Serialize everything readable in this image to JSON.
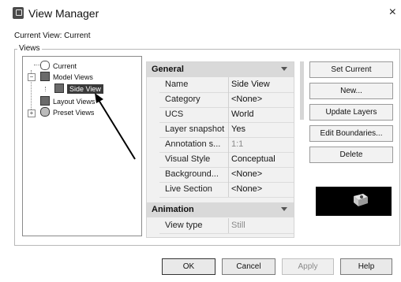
{
  "window": {
    "title": "View Manager",
    "close_glyph": "×"
  },
  "current_view_label": "Current View: Current",
  "views_group_label": "Views",
  "tree": {
    "current": "Current",
    "model_views": "Model Views",
    "side_view": "Side View",
    "layout_views": "Layout Views",
    "preset_views": "Preset Views",
    "expand_glyph": "+",
    "collapse_glyph": "−"
  },
  "properties": {
    "general_header": "General",
    "general_rows": [
      {
        "key": "Name",
        "value": "Side View"
      },
      {
        "key": "Category",
        "value": "<None>"
      },
      {
        "key": "UCS",
        "value": "World"
      },
      {
        "key": "Layer snapshot",
        "value": "Yes"
      },
      {
        "key": "Annotation s...",
        "value": "1:1"
      },
      {
        "key": "Visual Style",
        "value": "Conceptual"
      },
      {
        "key": "Background...",
        "value": "<None>"
      },
      {
        "key": "Live Section",
        "value": "<None>"
      }
    ],
    "animation_header": "Animation",
    "animation_rows": [
      {
        "key": "View type",
        "value": "Still"
      }
    ]
  },
  "side_buttons": {
    "set_current": "Set Current",
    "new": "New...",
    "update_layers": "Update Layers",
    "edit_boundaries": "Edit Boundaries...",
    "delete": "Delete"
  },
  "bottom_buttons": {
    "ok": "OK",
    "cancel": "Cancel",
    "apply": "Apply",
    "help": "Help"
  },
  "icons": {
    "app": "autocad-view-manager-icon",
    "preview": "3d-part-preview-icon"
  },
  "colors": {
    "selection": "#3a3a3a",
    "section_header": "#d9d9d9",
    "grid_bg": "#f1f1f1"
  }
}
